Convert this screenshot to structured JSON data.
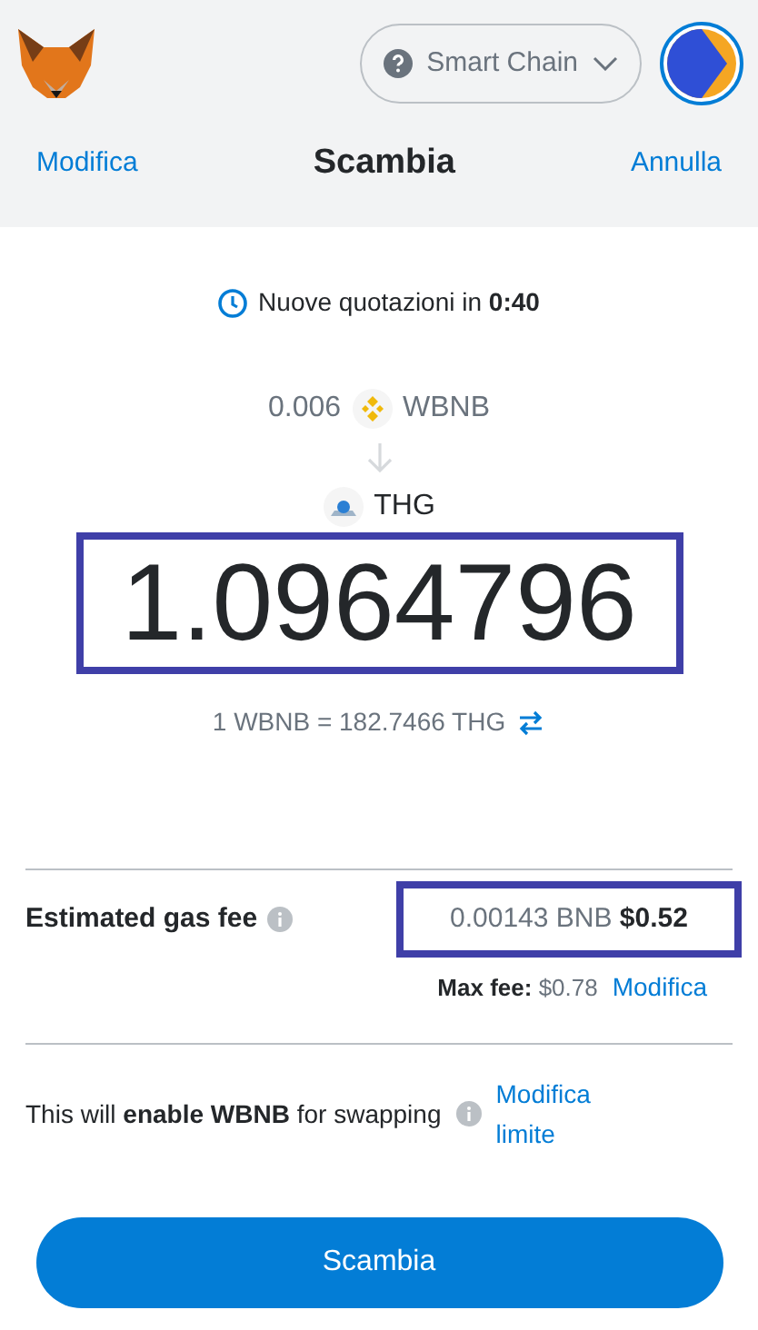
{
  "header": {
    "network": {
      "label": "Smart Chain"
    },
    "left_link": "Modifica",
    "title": "Scambia",
    "right_link": "Annulla"
  },
  "quote_timer": {
    "label": "Nuove quotazioni in",
    "time": "0:40"
  },
  "from": {
    "amount": "0.006",
    "token": "WBNB"
  },
  "to": {
    "token": "THG"
  },
  "received_amount": {
    "value": "1.0964796",
    "highlighted": true
  },
  "rate": "1 WBNB = 182.7466 THG",
  "gas_fee": {
    "label": "Estimated gas fee",
    "value": "0.00143 BNB **$0.52**",
    "highlighted": true,
    "max_fee_label": "Max fee:",
    "max_fee_value": "$0.78",
    "edit_link": "Modifica"
  },
  "approval": {
    "text": "This will **enable WBNB** for swapping",
    "edit_link": "Modifica limite"
  },
  "swap_button": "Scambia"
}
